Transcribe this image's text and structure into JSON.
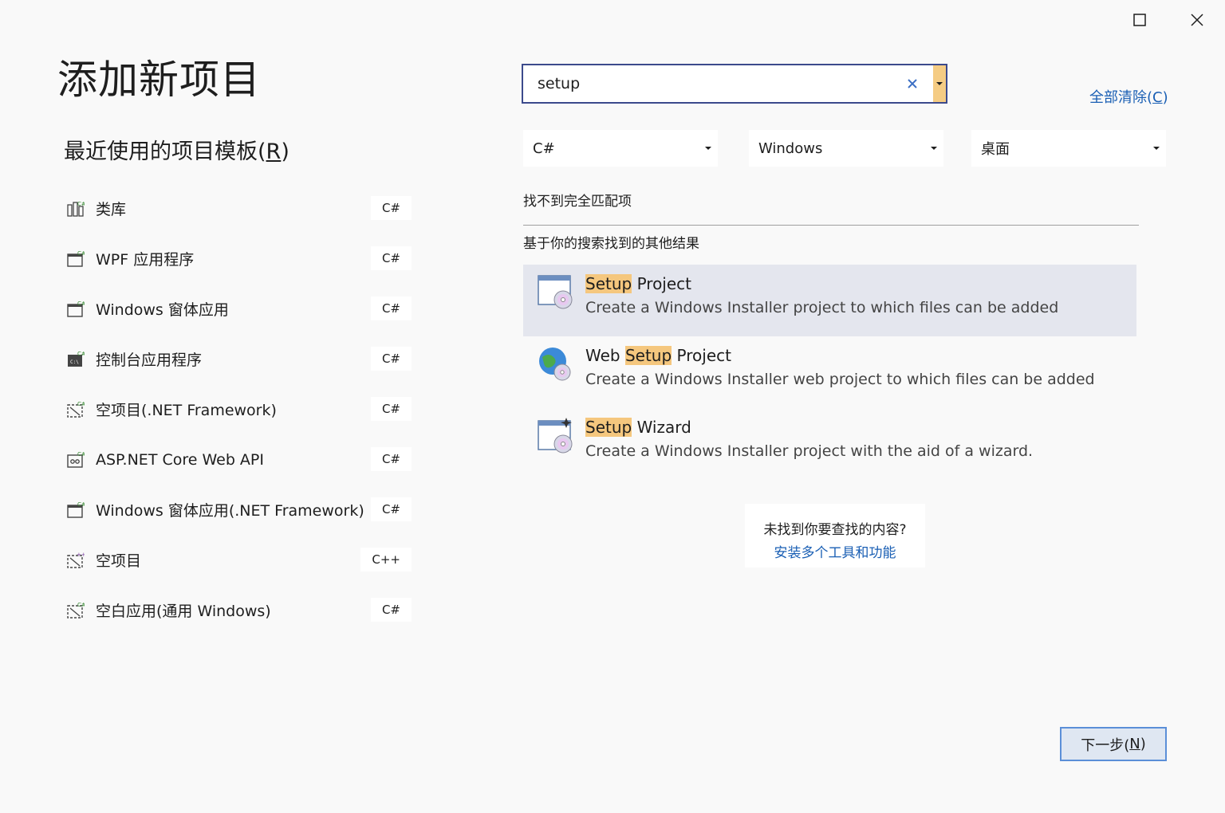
{
  "window": {
    "maximize_icon": "maximize-icon",
    "close_icon": "close-icon"
  },
  "page_title": "添加新项目",
  "recent": {
    "heading_prefix": "最近使用的项目模板(",
    "heading_key": "R",
    "heading_suffix": ")",
    "items": [
      {
        "label": "类库",
        "lang": "C#",
        "icon": "class-library-icon"
      },
      {
        "label": "WPF 应用程序",
        "lang": "C#",
        "icon": "wpf-app-icon"
      },
      {
        "label": "Windows 窗体应用",
        "lang": "C#",
        "icon": "windows-forms-icon"
      },
      {
        "label": "控制台应用程序",
        "lang": "C#",
        "icon": "console-app-icon"
      },
      {
        "label": "空项目(.NET Framework)",
        "lang": "C#",
        "icon": "empty-project-icon"
      },
      {
        "label": "ASP.NET Core Web API",
        "lang": "C#",
        "icon": "web-api-icon"
      },
      {
        "label": "Windows 窗体应用(.NET Framework)",
        "lang": "C#",
        "icon": "windows-forms-icon"
      },
      {
        "label": "空项目",
        "lang": "C++",
        "icon": "empty-project-icon"
      },
      {
        "label": "空白应用(通用 Windows)",
        "lang": "C#",
        "icon": "blank-app-icon"
      }
    ]
  },
  "search": {
    "value": "setup",
    "clear_icon": "clear-icon",
    "dropdown_icon": "chevron-down-icon"
  },
  "clear_all": {
    "prefix": "全部清除(",
    "key": "C",
    "suffix": ")"
  },
  "filters": [
    {
      "value": "C#"
    },
    {
      "value": "Windows"
    },
    {
      "value": "桌面"
    }
  ],
  "no_exact_match": "找不到完全匹配项",
  "other_results_label": "基于你的搜索找到的其他结果",
  "results": [
    {
      "title_pre": "",
      "title_hl": "Setup",
      "title_post": " Project",
      "desc": "Create a Windows Installer project to which files can be added",
      "icon": "setup-project-icon",
      "selected": true
    },
    {
      "title_pre": "Web ",
      "title_hl": "Setup",
      "title_post": " Project",
      "desc": "Create a Windows Installer web project to which files can be added",
      "icon": "web-setup-project-icon",
      "selected": false
    },
    {
      "title_pre": "",
      "title_hl": "Setup",
      "title_post": " Wizard",
      "desc": "Create a Windows Installer project with the aid of a wizard.",
      "icon": "setup-wizard-icon",
      "selected": false
    }
  ],
  "help": {
    "question": "未找到你要查找的内容?",
    "link": "安装多个工具和功能"
  },
  "next_button": {
    "prefix": "下一步(",
    "key": "N",
    "suffix": ")"
  },
  "colors": {
    "accent_link": "#1a5fb4",
    "search_border": "#3c4a8c",
    "highlight": "#f5c77e",
    "selected_row": "#e4e6ee"
  }
}
